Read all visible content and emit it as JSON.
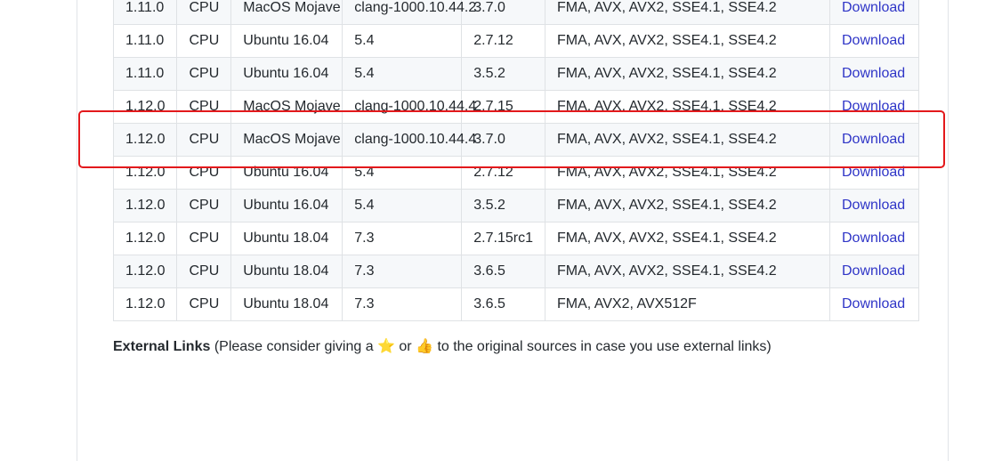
{
  "table": {
    "rows": [
      {
        "version": "1.11.0",
        "device": "CPU",
        "os": "MacOS Mojave",
        "compiler": "clang-1000.10.44.2",
        "python": "3.7.0",
        "extensions": "FMA, AVX, AVX2, SSE4.1, SSE4.2",
        "download": "Download"
      },
      {
        "version": "1.11.0",
        "device": "CPU",
        "os": "Ubuntu 16.04",
        "compiler": "5.4",
        "python": "2.7.12",
        "extensions": "FMA, AVX, AVX2, SSE4.1, SSE4.2",
        "download": "Download"
      },
      {
        "version": "1.11.0",
        "device": "CPU",
        "os": "Ubuntu 16.04",
        "compiler": "5.4",
        "python": "3.5.2",
        "extensions": "FMA, AVX, AVX2, SSE4.1, SSE4.2",
        "download": "Download"
      },
      {
        "version": "1.12.0",
        "device": "CPU",
        "os": "MacOS Mojave",
        "compiler": "clang-1000.10.44.4",
        "python": "2.7.15",
        "extensions": "FMA, AVX, AVX2, SSE4.1, SSE4.2",
        "download": "Download"
      },
      {
        "version": "1.12.0",
        "device": "CPU",
        "os": "MacOS Mojave",
        "compiler": "clang-1000.10.44.4",
        "python": "3.7.0",
        "extensions": "FMA, AVX, AVX2, SSE4.1, SSE4.2",
        "download": "Download"
      },
      {
        "version": "1.12.0",
        "device": "CPU",
        "os": "Ubuntu 16.04",
        "compiler": "5.4",
        "python": "2.7.12",
        "extensions": "FMA, AVX, AVX2, SSE4.1, SSE4.2",
        "download": "Download"
      },
      {
        "version": "1.12.0",
        "device": "CPU",
        "os": "Ubuntu 16.04",
        "compiler": "5.4",
        "python": "3.5.2",
        "extensions": "FMA, AVX, AVX2, SSE4.1, SSE4.2",
        "download": "Download"
      },
      {
        "version": "1.12.0",
        "device": "CPU",
        "os": "Ubuntu 18.04",
        "compiler": "7.3",
        "python": "2.7.15rc1",
        "extensions": "FMA, AVX, AVX2, SSE4.1, SSE4.2",
        "download": "Download"
      },
      {
        "version": "1.12.0",
        "device": "CPU",
        "os": "Ubuntu 18.04",
        "compiler": "7.3",
        "python": "3.6.5",
        "extensions": "FMA, AVX, AVX2, SSE4.1, SSE4.2",
        "download": "Download"
      },
      {
        "version": "1.12.0",
        "device": "CPU",
        "os": "Ubuntu 18.04",
        "compiler": "7.3",
        "python": "3.6.5",
        "extensions": "FMA, AVX2, AVX512F",
        "download": "Download"
      }
    ]
  },
  "highlight": {
    "row_index": 4,
    "color": "#e3191c"
  },
  "external_links": {
    "heading": "External Links",
    "text_before": " (Please consider giving a ",
    "star": "⭐",
    "or": " or ",
    "thumb": "👍",
    "text_after": " to the original sources in case you use external links)"
  },
  "colors": {
    "link": "#2f35c7",
    "row_alt": "#f6f8fa",
    "border": "#dfe2e5"
  }
}
